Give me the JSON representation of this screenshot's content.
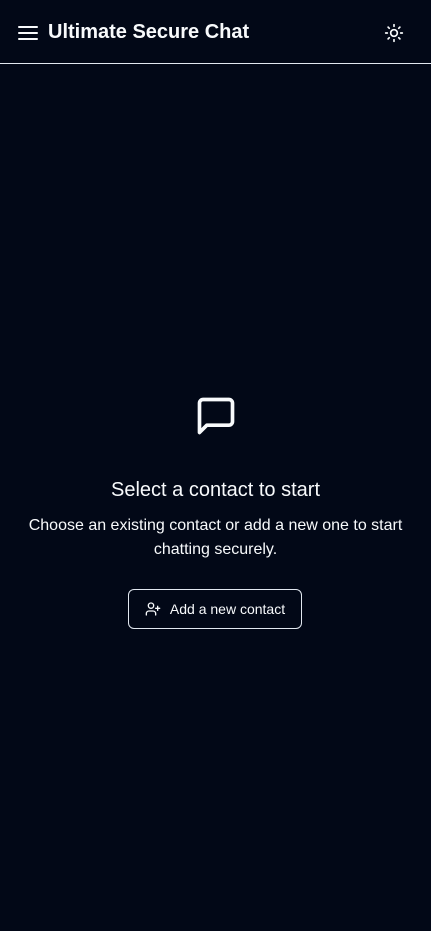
{
  "header": {
    "title": "Ultimate Secure Chat",
    "menu_icon": "hamburger-menu-icon",
    "theme_icon": "sun-icon"
  },
  "empty_state": {
    "icon": "message-square-icon",
    "title": "Select a contact to start",
    "description": "Choose an existing contact or add a new one to start chatting securely.",
    "add_button_label": "Add a new contact",
    "add_button_icon": "user-plus-icon"
  },
  "colors": {
    "background": "#020817",
    "foreground": "#f8fafc",
    "border": "#e2e8f0"
  }
}
